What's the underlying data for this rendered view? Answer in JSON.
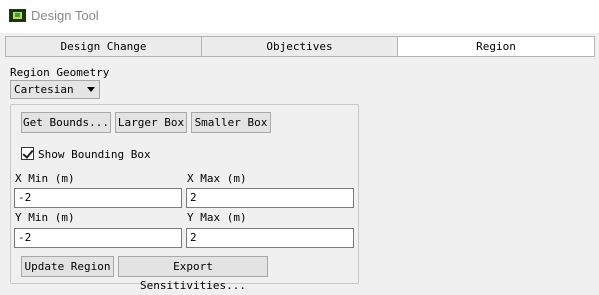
{
  "window": {
    "title": "Design Tool"
  },
  "tabs": [
    {
      "label": "Design Change",
      "active": false
    },
    {
      "label": "Objectives",
      "active": false
    },
    {
      "label": "Region",
      "active": true
    }
  ],
  "region": {
    "geometry_label": "Region Geometry",
    "geometry_value": "Cartesian",
    "buttons": {
      "get_bounds": "Get Bounds...",
      "larger_box": "Larger Box",
      "smaller_box": "Smaller Box",
      "update_region": "Update Region",
      "export_sensitivities": "Export Sensitivities..."
    },
    "show_bounding_box": {
      "label": "Show Bounding Box",
      "checked": true
    },
    "x_min": {
      "label": "X Min (m)",
      "value": "-2"
    },
    "x_max": {
      "label": "X Max (m)",
      "value": "2"
    },
    "y_min": {
      "label": "Y Min (m)",
      "value": "-2"
    },
    "y_max": {
      "label": "Y Max (m)",
      "value": "2"
    }
  }
}
